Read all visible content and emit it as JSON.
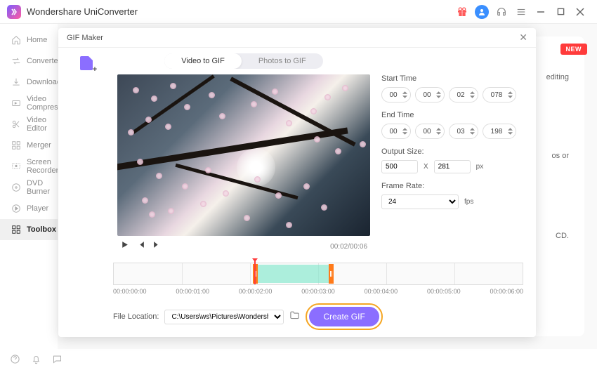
{
  "app": {
    "name": "Wondershare UniConverter"
  },
  "sidebar": {
    "items": [
      {
        "label": "Home"
      },
      {
        "label": "Converter"
      },
      {
        "label": "Downloader"
      },
      {
        "label": "Video Compressor"
      },
      {
        "label": "Video Editor"
      },
      {
        "label": "Merger"
      },
      {
        "label": "Screen Recorder"
      },
      {
        "label": "DVD Burner"
      },
      {
        "label": "Player"
      },
      {
        "label": "Toolbox"
      }
    ]
  },
  "background": {
    "new_badge": "NEW",
    "line1": "editing",
    "line2": "os or",
    "line3": "CD."
  },
  "modal": {
    "title": "GIF Maker",
    "tabs": {
      "video": "Video to GIF",
      "photos": "Photos to GIF"
    },
    "playback": {
      "time": "00:02/00:06"
    },
    "start": {
      "label": "Start Time",
      "hh": "00",
      "mm": "00",
      "ss": "02",
      "ms": "078"
    },
    "end": {
      "label": "End Time",
      "hh": "00",
      "mm": "00",
      "ss": "03",
      "ms": "198"
    },
    "output_size": {
      "label": "Output Size:",
      "w": "500",
      "sep": "X",
      "h": "281",
      "unit": "px"
    },
    "frame_rate": {
      "label": "Frame Rate:",
      "value": "24",
      "unit": "fps"
    },
    "timeline": {
      "labels": [
        "00:00:00:00",
        "00:00:01:00",
        "00:00:02:00",
        "00:00:03:00",
        "00:00:04:00",
        "00:00:05:00",
        "00:00:06:00"
      ]
    },
    "file_location": {
      "label": "File Location:",
      "path": "C:\\Users\\ws\\Pictures\\Wondershare"
    },
    "create_button": "Create GIF"
  }
}
